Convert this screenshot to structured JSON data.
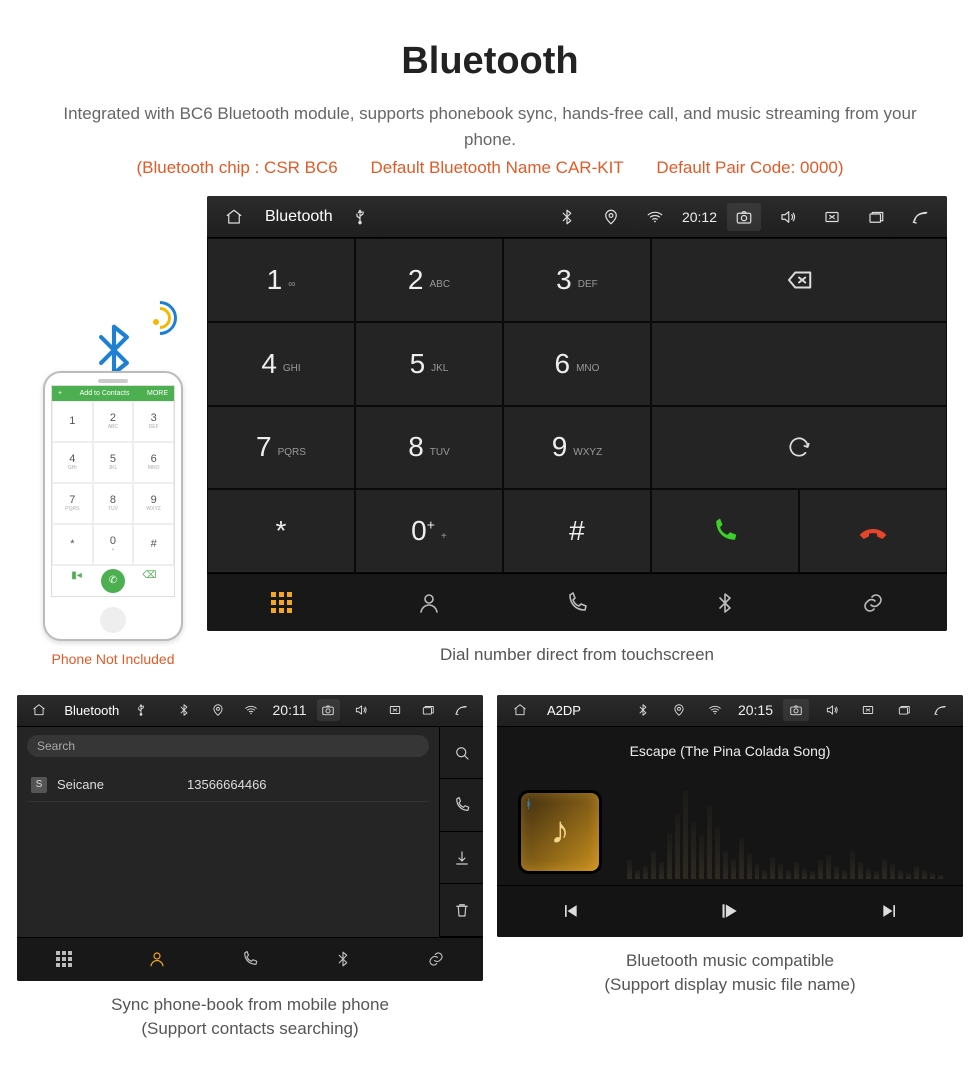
{
  "header": {
    "title": "Bluetooth",
    "subtitle": "Integrated with BC6 Bluetooth module, supports phonebook sync, hands-free call, and music streaming from your phone.",
    "chip_label": "(Bluetooth chip : CSR BC6",
    "name_label": "Default Bluetooth Name CAR-KIT",
    "pair_label": "Default Pair Code: 0000)"
  },
  "phone_mock": {
    "top_left": "+",
    "top_text": "Add to Contacts",
    "top_right": "MORE",
    "keys": [
      {
        "n": "1",
        "l": ""
      },
      {
        "n": "2",
        "l": "ABC"
      },
      {
        "n": "3",
        "l": "DEF"
      },
      {
        "n": "4",
        "l": "GHI"
      },
      {
        "n": "5",
        "l": "JKL"
      },
      {
        "n": "6",
        "l": "MNO"
      },
      {
        "n": "7",
        "l": "PQRS"
      },
      {
        "n": "8",
        "l": "TUV"
      },
      {
        "n": "9",
        "l": "WXYZ"
      },
      {
        "n": "*",
        "l": ""
      },
      {
        "n": "0",
        "l": "+"
      },
      {
        "n": "#",
        "l": ""
      }
    ],
    "caption": "Phone Not Included"
  },
  "dialer": {
    "status": {
      "title": "Bluetooth",
      "time": "20:12"
    },
    "keys": [
      {
        "n": "1",
        "l": "∞"
      },
      {
        "n": "2",
        "l": "ABC"
      },
      {
        "n": "3",
        "l": "DEF"
      },
      {
        "n": "4",
        "l": "GHI"
      },
      {
        "n": "5",
        "l": "JKL"
      },
      {
        "n": "6",
        "l": "MNO"
      },
      {
        "n": "7",
        "l": "PQRS"
      },
      {
        "n": "8",
        "l": "TUV"
      },
      {
        "n": "9",
        "l": "WXYZ"
      },
      {
        "n": "*",
        "l": ""
      },
      {
        "n": "0",
        "l": "+",
        "plus": true
      },
      {
        "n": "#",
        "l": ""
      }
    ],
    "caption": "Dial number direct from touchscreen"
  },
  "phonebook": {
    "status": {
      "title": "Bluetooth",
      "time": "20:11"
    },
    "search_placeholder": "Search",
    "entries": [
      {
        "badge": "S",
        "name": "Seicane",
        "number": "13566664466"
      }
    ],
    "caption_l1": "Sync phone-book from mobile phone",
    "caption_l2": "(Support contacts searching)"
  },
  "music": {
    "status": {
      "title": "A2DP",
      "time": "20:15"
    },
    "track": "Escape (The Pina Colada Song)",
    "caption_l1": "Bluetooth music compatible",
    "caption_l2": "(Support display music file name)"
  }
}
